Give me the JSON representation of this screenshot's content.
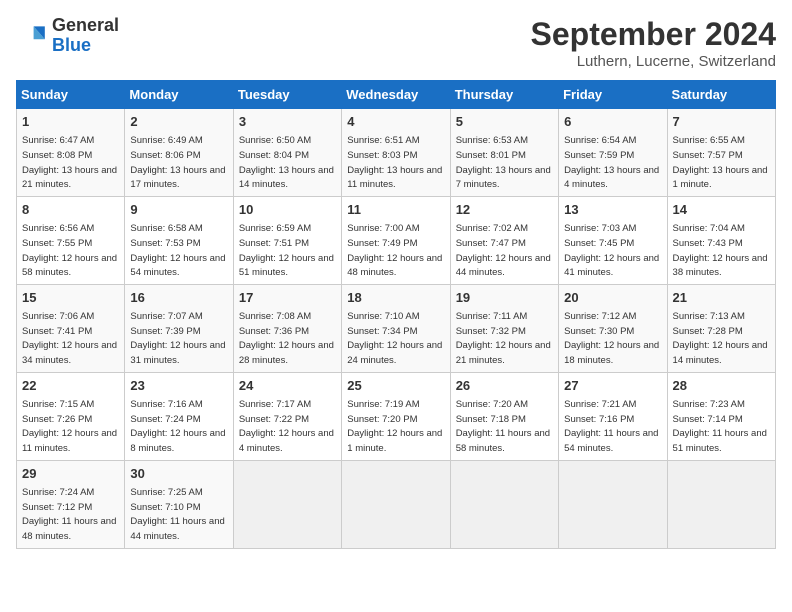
{
  "logo": {
    "general": "General",
    "blue": "Blue"
  },
  "title": "September 2024",
  "location": "Luthern, Lucerne, Switzerland",
  "days_of_week": [
    "Sunday",
    "Monday",
    "Tuesday",
    "Wednesday",
    "Thursday",
    "Friday",
    "Saturday"
  ],
  "weeks": [
    [
      {
        "day": "1",
        "sunrise": "6:47 AM",
        "sunset": "8:08 PM",
        "daylight": "13 hours and 21 minutes"
      },
      {
        "day": "2",
        "sunrise": "6:49 AM",
        "sunset": "8:06 PM",
        "daylight": "13 hours and 17 minutes"
      },
      {
        "day": "3",
        "sunrise": "6:50 AM",
        "sunset": "8:04 PM",
        "daylight": "13 hours and 14 minutes"
      },
      {
        "day": "4",
        "sunrise": "6:51 AM",
        "sunset": "8:03 PM",
        "daylight": "13 hours and 11 minutes"
      },
      {
        "day": "5",
        "sunrise": "6:53 AM",
        "sunset": "8:01 PM",
        "daylight": "13 hours and 7 minutes"
      },
      {
        "day": "6",
        "sunrise": "6:54 AM",
        "sunset": "7:59 PM",
        "daylight": "13 hours and 4 minutes"
      },
      {
        "day": "7",
        "sunrise": "6:55 AM",
        "sunset": "7:57 PM",
        "daylight": "13 hours and 1 minute"
      }
    ],
    [
      {
        "day": "8",
        "sunrise": "6:56 AM",
        "sunset": "7:55 PM",
        "daylight": "12 hours and 58 minutes"
      },
      {
        "day": "9",
        "sunrise": "6:58 AM",
        "sunset": "7:53 PM",
        "daylight": "12 hours and 54 minutes"
      },
      {
        "day": "10",
        "sunrise": "6:59 AM",
        "sunset": "7:51 PM",
        "daylight": "12 hours and 51 minutes"
      },
      {
        "day": "11",
        "sunrise": "7:00 AM",
        "sunset": "7:49 PM",
        "daylight": "12 hours and 48 minutes"
      },
      {
        "day": "12",
        "sunrise": "7:02 AM",
        "sunset": "7:47 PM",
        "daylight": "12 hours and 44 minutes"
      },
      {
        "day": "13",
        "sunrise": "7:03 AM",
        "sunset": "7:45 PM",
        "daylight": "12 hours and 41 minutes"
      },
      {
        "day": "14",
        "sunrise": "7:04 AM",
        "sunset": "7:43 PM",
        "daylight": "12 hours and 38 minutes"
      }
    ],
    [
      {
        "day": "15",
        "sunrise": "7:06 AM",
        "sunset": "7:41 PM",
        "daylight": "12 hours and 34 minutes"
      },
      {
        "day": "16",
        "sunrise": "7:07 AM",
        "sunset": "7:39 PM",
        "daylight": "12 hours and 31 minutes"
      },
      {
        "day": "17",
        "sunrise": "7:08 AM",
        "sunset": "7:36 PM",
        "daylight": "12 hours and 28 minutes"
      },
      {
        "day": "18",
        "sunrise": "7:10 AM",
        "sunset": "7:34 PM",
        "daylight": "12 hours and 24 minutes"
      },
      {
        "day": "19",
        "sunrise": "7:11 AM",
        "sunset": "7:32 PM",
        "daylight": "12 hours and 21 minutes"
      },
      {
        "day": "20",
        "sunrise": "7:12 AM",
        "sunset": "7:30 PM",
        "daylight": "12 hours and 18 minutes"
      },
      {
        "day": "21",
        "sunrise": "7:13 AM",
        "sunset": "7:28 PM",
        "daylight": "12 hours and 14 minutes"
      }
    ],
    [
      {
        "day": "22",
        "sunrise": "7:15 AM",
        "sunset": "7:26 PM",
        "daylight": "12 hours and 11 minutes"
      },
      {
        "day": "23",
        "sunrise": "7:16 AM",
        "sunset": "7:24 PM",
        "daylight": "12 hours and 8 minutes"
      },
      {
        "day": "24",
        "sunrise": "7:17 AM",
        "sunset": "7:22 PM",
        "daylight": "12 hours and 4 minutes"
      },
      {
        "day": "25",
        "sunrise": "7:19 AM",
        "sunset": "7:20 PM",
        "daylight": "12 hours and 1 minute"
      },
      {
        "day": "26",
        "sunrise": "7:20 AM",
        "sunset": "7:18 PM",
        "daylight": "11 hours and 58 minutes"
      },
      {
        "day": "27",
        "sunrise": "7:21 AM",
        "sunset": "7:16 PM",
        "daylight": "11 hours and 54 minutes"
      },
      {
        "day": "28",
        "sunrise": "7:23 AM",
        "sunset": "7:14 PM",
        "daylight": "11 hours and 51 minutes"
      }
    ],
    [
      {
        "day": "29",
        "sunrise": "7:24 AM",
        "sunset": "7:12 PM",
        "daylight": "11 hours and 48 minutes"
      },
      {
        "day": "30",
        "sunrise": "7:25 AM",
        "sunset": "7:10 PM",
        "daylight": "11 hours and 44 minutes"
      },
      null,
      null,
      null,
      null,
      null
    ]
  ]
}
